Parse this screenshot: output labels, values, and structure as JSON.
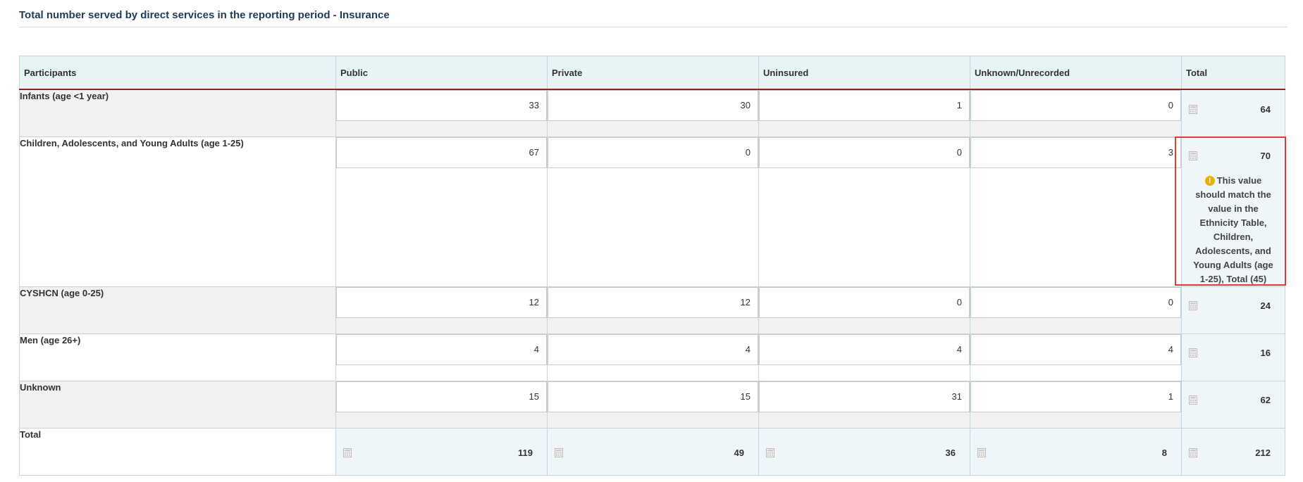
{
  "section_title": "Total number served by direct services in the reporting period - Insurance",
  "columns": [
    "Participants",
    "Public",
    "Private",
    "Uninsured",
    "Unknown/Unrecorded",
    "Total"
  ],
  "rows": [
    {
      "label": "Infants (age <1 year)",
      "values": [
        "33",
        "30",
        "1",
        "0"
      ],
      "total": "64"
    },
    {
      "label": "Children, Adolescents, and Young Adults (age 1-25)",
      "values": [
        "67",
        "0",
        "0",
        "3"
      ],
      "total": "70",
      "warning": "This value should match the value in the Ethnicity Table, Children, Adolescents, and Young Adults (age 1-25), Total (45)"
    },
    {
      "label": "CYSHCN (age 0-25)",
      "values": [
        "12",
        "12",
        "0",
        "0"
      ],
      "total": "24"
    },
    {
      "label": "Men (age 26+)",
      "values": [
        "4",
        "4",
        "4",
        "4"
      ],
      "total": "16"
    },
    {
      "label": "Unknown",
      "values": [
        "15",
        "15",
        "31",
        "1"
      ],
      "total": "62"
    }
  ],
  "totals_row": {
    "label": "Total",
    "values": [
      "119",
      "49",
      "36",
      "8"
    ],
    "total": "212"
  },
  "icons": {
    "calculated": "calculator-icon",
    "warning": "exclamation-icon"
  },
  "colors": {
    "header_bg": "#e6f4f5",
    "header_rule": "#8b2323",
    "warning_icon": "#e8b100",
    "highlight_border": "#e03a3a"
  }
}
